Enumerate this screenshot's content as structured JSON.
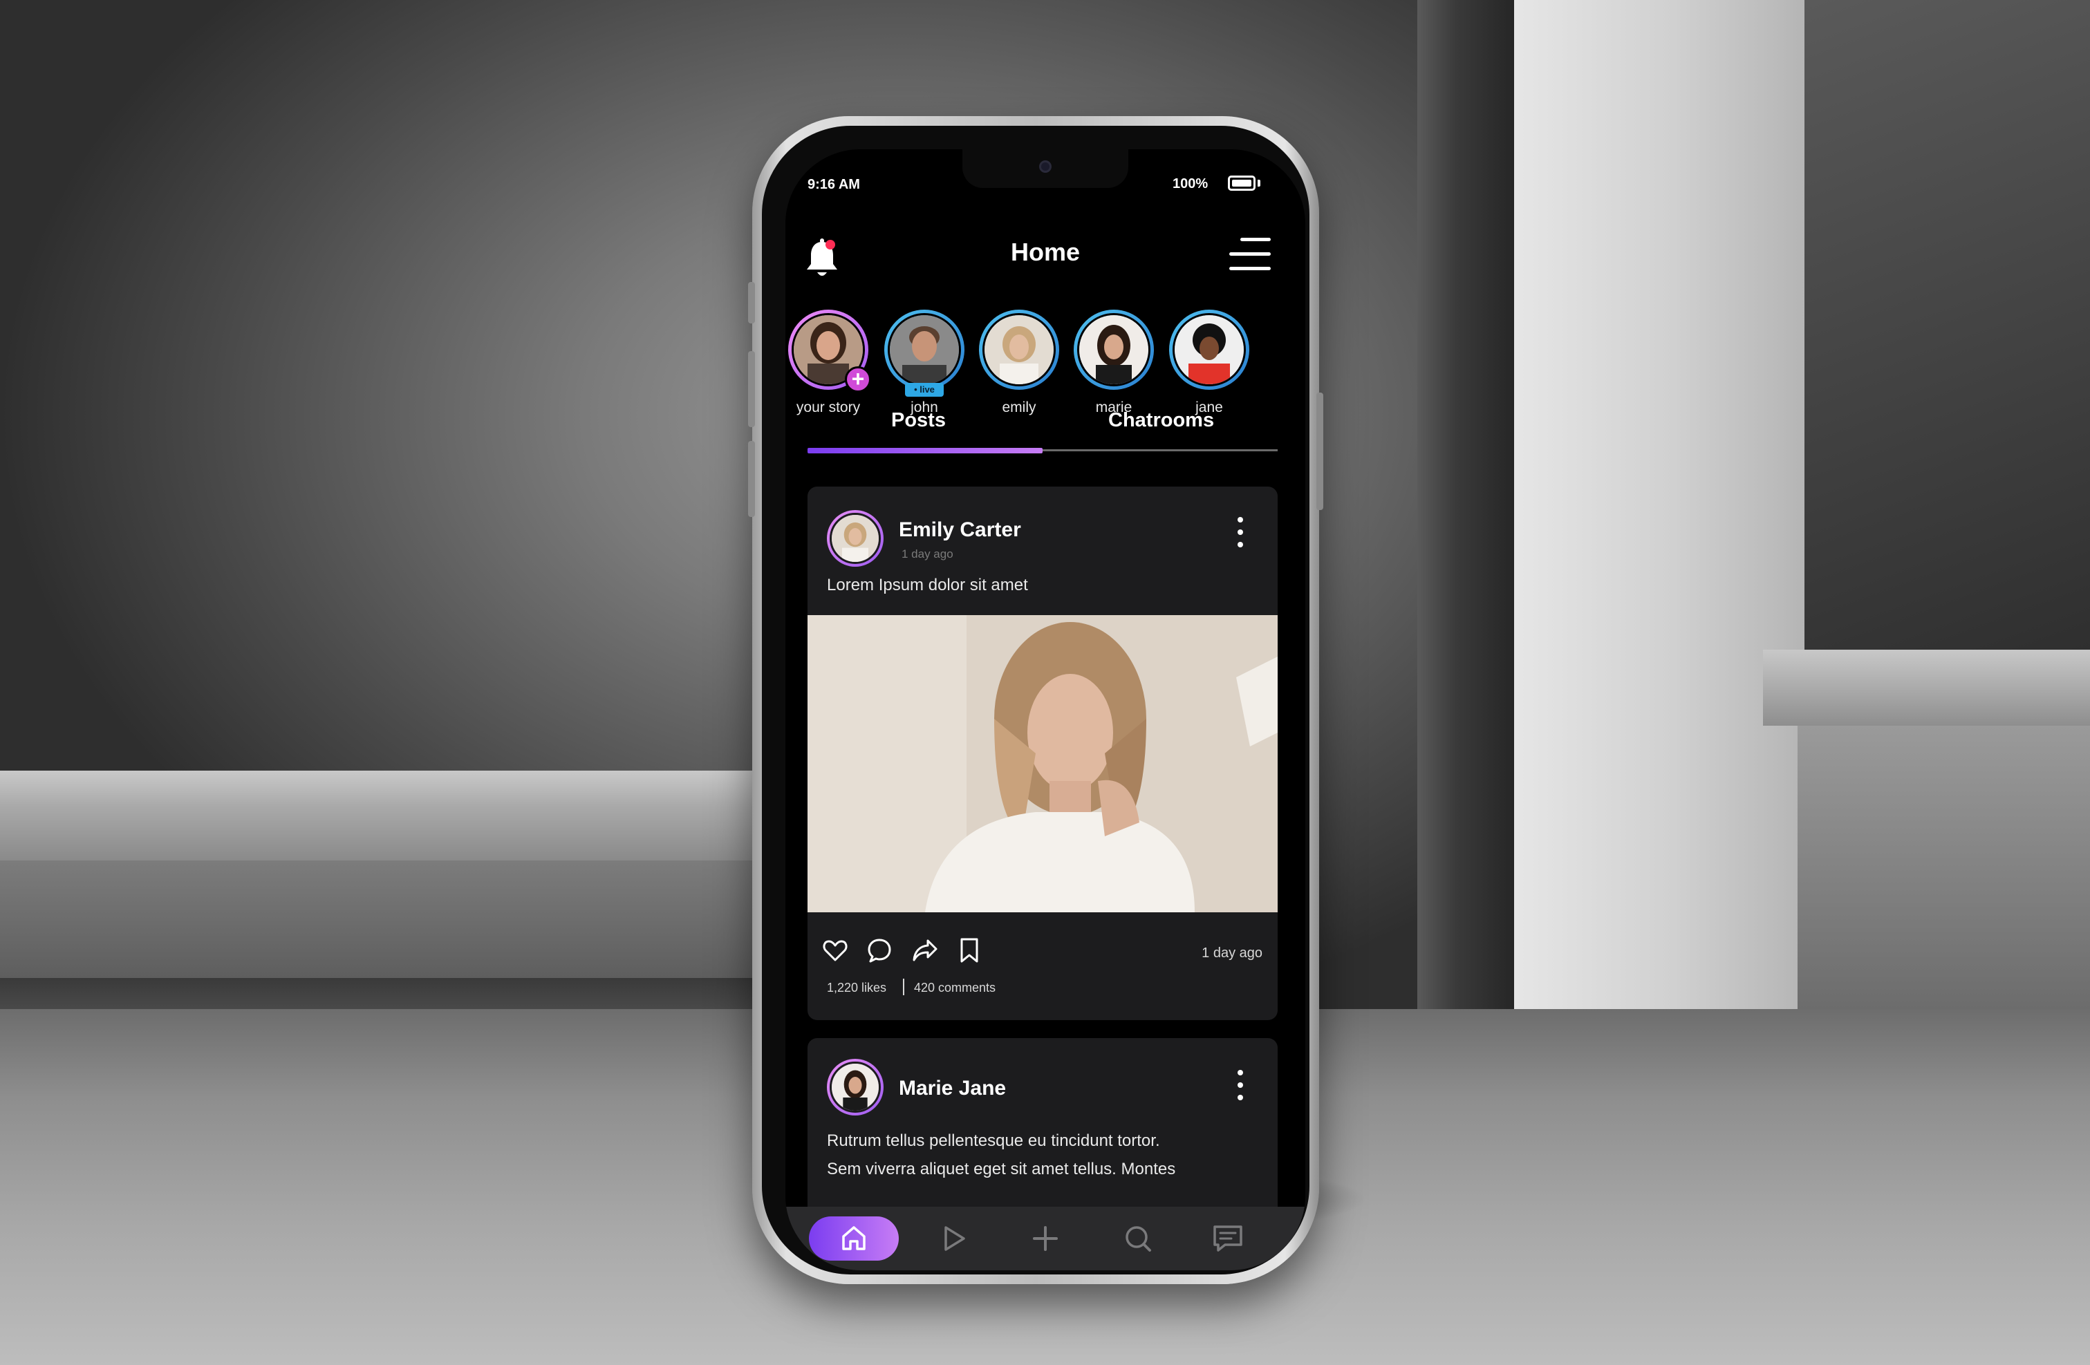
{
  "status_bar": {
    "time": "9:16 AM",
    "battery": "100%"
  },
  "header": {
    "title": "Home"
  },
  "stories": [
    {
      "name": "your story",
      "badge": "+"
    },
    {
      "name": "john",
      "badge": "• live"
    },
    {
      "name": "emily"
    },
    {
      "name": "marie"
    },
    {
      "name": "jane"
    }
  ],
  "tabs": [
    {
      "label": "Posts",
      "active": true
    },
    {
      "label": "Chatrooms",
      "active": false
    }
  ],
  "posts": [
    {
      "author": "Emily Carter",
      "time": "1 day ago",
      "text": "Lorem Ipsum dolor sit amet",
      "likes": "1,220 likes",
      "comments": "420 comments",
      "date": "1 day ago"
    },
    {
      "author": "Marie Jane",
      "text_line1": "Rutrum tellus pellentesque eu tincidunt tortor.",
      "text_line2": "Sem viverra aliquet eget sit amet tellus. Montes"
    }
  ],
  "bottom_nav": [
    {
      "icon": "home-icon",
      "active": true
    },
    {
      "icon": "play-icon"
    },
    {
      "icon": "plus-icon"
    },
    {
      "icon": "search-icon"
    },
    {
      "icon": "chat-icon"
    }
  ],
  "colors": {
    "accent_start": "#7b3df0",
    "accent_end": "#c77df5",
    "notification_dot": "#ff2d55",
    "live_badge": "#2ea8e6",
    "card_bg": "#1c1c1e"
  }
}
